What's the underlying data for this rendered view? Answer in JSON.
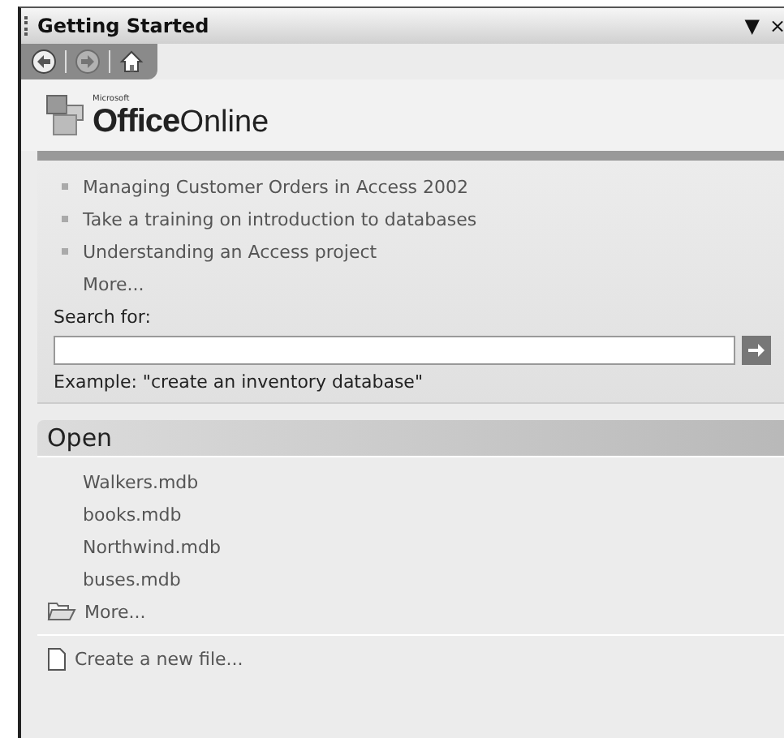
{
  "window": {
    "title": "Getting Started",
    "menu_glyph": "▼",
    "close_glyph": "×"
  },
  "nav": [
    {
      "kind": "back",
      "disabled": false
    },
    {
      "kind": "forward",
      "disabled": true
    },
    {
      "kind": "home",
      "disabled": false
    }
  ],
  "logo": {
    "brand": "Microsoft",
    "name": "Office",
    "suffix": "Online"
  },
  "links": [
    {
      "text": "Managing Customer Orders in Access 2002"
    },
    {
      "text": "Take a training on introduction to databases"
    },
    {
      "text": "Understanding an Access project"
    }
  ],
  "links_more": "More...",
  "search": {
    "label": "Search for:",
    "example": "Example:  \"create an inventory database\""
  },
  "open": {
    "title": "Open",
    "files": [
      "Walkers.mdb",
      "books.mdb",
      "Northwind.mdb",
      "buses.mdb"
    ],
    "more": "More...",
    "create": "Create a new file..."
  }
}
